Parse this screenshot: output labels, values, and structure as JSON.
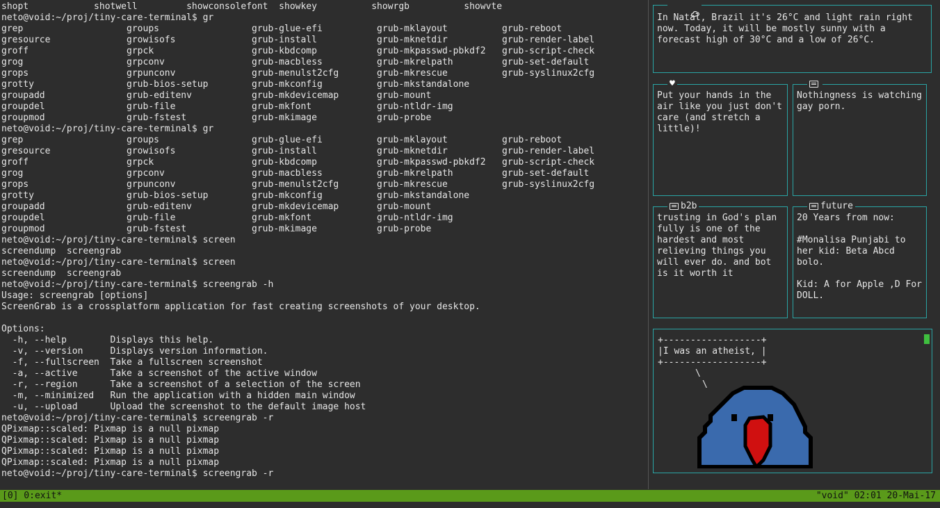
{
  "terminal": {
    "lines": [
      "shopt            shotwell         showconsolefont  showkey          showrgb          showvte",
      "neto@void:~/proj/tiny-care-terminal$ gr",
      "grep                   groups                 grub-glue-efi          grub-mklayout          grub-reboot",
      "gresource              growisofs              grub-install           grub-mknetdir          grub-render-label",
      "groff                  grpck                  grub-kbdcomp           grub-mkpasswd-pbkdf2   grub-script-check",
      "grog                   grpconv                grub-macbless          grub-mkrelpath         grub-set-default",
      "grops                  grpunconv              grub-menulst2cfg       grub-mkrescue          grub-syslinux2cfg",
      "grotty                 grub-bios-setup        grub-mkconfig          grub-mkstandalone",
      "groupadd               grub-editenv           grub-mkdevicemap       grub-mount",
      "groupdel               grub-file              grub-mkfont            grub-ntldr-img",
      "groupmod               grub-fstest            grub-mkimage           grub-probe",
      "neto@void:~/proj/tiny-care-terminal$ gr",
      "grep                   groups                 grub-glue-efi          grub-mklayout          grub-reboot",
      "gresource              growisofs              grub-install           grub-mknetdir          grub-render-label",
      "groff                  grpck                  grub-kbdcomp           grub-mkpasswd-pbkdf2   grub-script-check",
      "grog                   grpconv                grub-macbless          grub-mkrelpath         grub-set-default",
      "grops                  grpunconv              grub-menulst2cfg       grub-mkrescue          grub-syslinux2cfg",
      "grotty                 grub-bios-setup        grub-mkconfig          grub-mkstandalone",
      "groupadd               grub-editenv           grub-mkdevicemap       grub-mount",
      "groupdel               grub-file              grub-mkfont            grub-ntldr-img",
      "groupmod               grub-fstest            grub-mkimage           grub-probe",
      "neto@void:~/proj/tiny-care-terminal$ screen",
      "screendump  screengrab",
      "neto@void:~/proj/tiny-care-terminal$ screen",
      "screendump  screengrab",
      "neto@void:~/proj/tiny-care-terminal$ screengrab -h",
      "Usage: screengrab [options]",
      "ScreenGrab is a crossplatform application for fast creating screenshots of your desktop.",
      "",
      "Options:",
      "  -h, --help        Displays this help.",
      "  -v, --version     Displays version information.",
      "  -f, --fullscreen  Take a fullscreen screenshot",
      "  -a, --active      Take a screenshot of the active window",
      "  -r, --region      Take a screenshot of a selection of the screen",
      "  -m, --minimized   Run the application with a hidden main window",
      "  -u, --upload      Upload the screenshot to the default image host",
      "neto@void:~/proj/tiny-care-terminal$ screengrab -r",
      "QPixmap::scaled: Pixmap is a null pixmap",
      "QPixmap::scaled: Pixmap is a null pixmap",
      "QPixmap::scaled: Pixmap is a null pixmap",
      "QPixmap::scaled: Pixmap is a null pixmap",
      "neto@void:~/proj/tiny-care-terminal$ screengrab -r"
    ]
  },
  "weather": {
    "icon": "cloud-icon",
    "text": "In Natal, Brazil it's 26°C and light rain right now. Today, it will be mostly sunny with a forecast high of 30°C and a low of 26°C."
  },
  "care": {
    "icon": "heart-icon",
    "heart_glyph": "♥",
    "text": "Put your hands in the air like you just don't care (and stretch a little)!"
  },
  "tweet1": {
    "icon": "message-icon",
    "text": "Nothingness is watching gay porn."
  },
  "b2b": {
    "title": "b2b",
    "icon": "message-icon",
    "text": "trusting in God's plan fully is one of the hardest and most relieving things you will ever do. and bot is it worth it"
  },
  "future": {
    "title": "future",
    "icon": "message-icon",
    "text": "20 Years from now:\n\n#Monalisa Punjabi to her kid: Beta Abcd bolo.\n\nKid: A for Apple ,D For DOLL."
  },
  "party_parrot": {
    "bubble_top": "+------------------+",
    "bubble_text": "|I was an atheist, |",
    "bubble_bottom": "+------------------+",
    "tail1": "\\",
    "tail2": "\\"
  },
  "statusbar": {
    "left": "[0] 0:exit*",
    "right": "\"void\" 02:01 20-Mai-17"
  },
  "colors": {
    "border": "#2aa6a6",
    "status": "#5a9a1a",
    "bird_blue": "#3a6aad",
    "bird_red": "#d01010"
  }
}
